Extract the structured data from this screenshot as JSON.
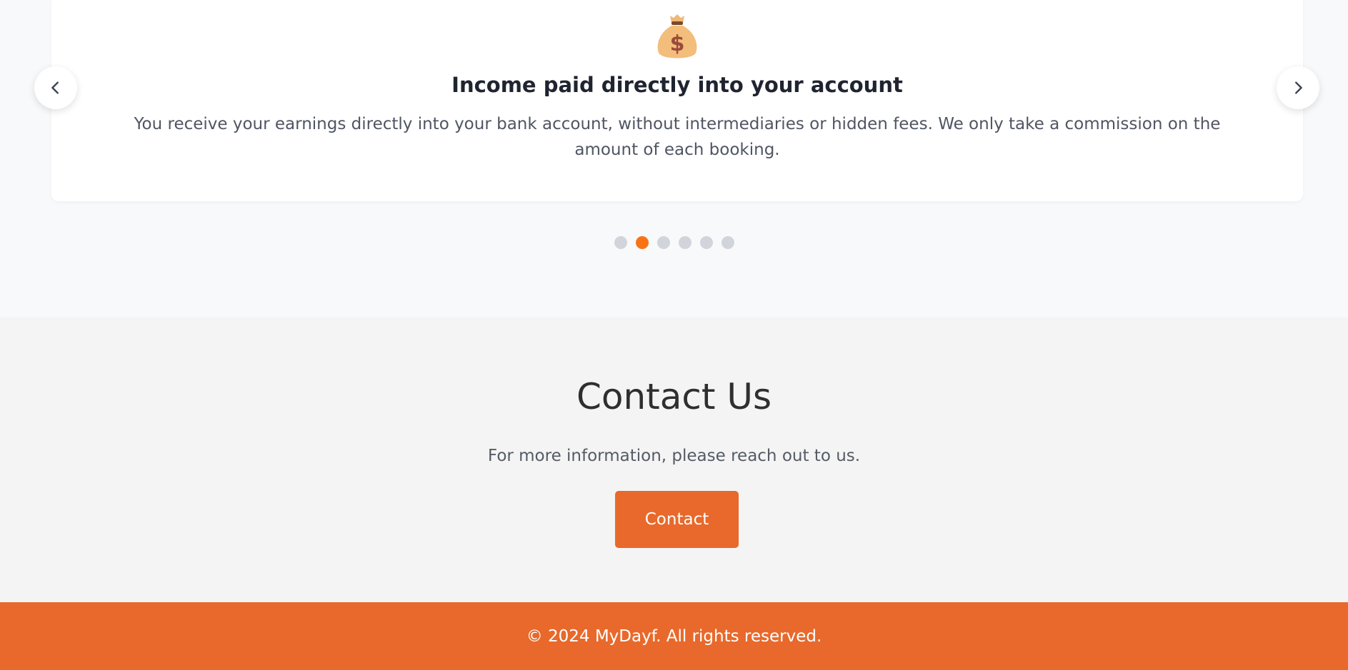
{
  "carousel": {
    "slide": {
      "icon": "money-bag-icon",
      "title": "Income paid directly into your account",
      "text": "You receive your earnings directly into your bank account, without intermediaries or hidden fees. We only take a commission on the amount of each booking."
    },
    "prev_icon": "chevron-left-icon",
    "next_icon": "chevron-right-icon",
    "slide_count": 6,
    "active_slide": 2,
    "accent_color": "#f97316"
  },
  "contact": {
    "title": "Contact Us",
    "text": "For more information, please reach out to us.",
    "button_label": "Contact"
  },
  "footer": {
    "text": "© 2024 MyDayf. All rights reserved."
  },
  "colors": {
    "brand": "#e8692b",
    "page_bg": "#f8f9fa",
    "contact_bg": "#f4f4f4"
  }
}
